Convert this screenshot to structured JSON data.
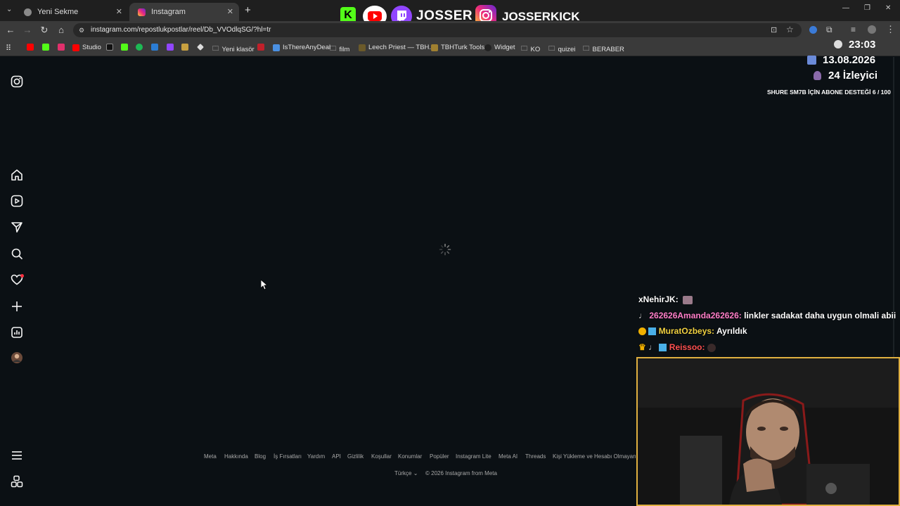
{
  "tabs": [
    {
      "title": "Yeni Sekme",
      "close": "✕"
    },
    {
      "title": "Instagram",
      "close": "✕"
    }
  ],
  "new_tab": "+",
  "window_controls": {
    "minimize": "—",
    "restore": "❐",
    "close": "✕"
  },
  "address_bar": {
    "url": "instagram.com/repostlukpostlar/reel/Db_VVOdlqSG/?hl=tr"
  },
  "bookmarks": [
    {
      "label": "Studio",
      "icon": "youtube-icon",
      "color": "#ff0000"
    },
    {
      "label": "Yeni klasör",
      "icon": "folder-icon"
    },
    {
      "label": "IsThereAnyDeal",
      "icon": "itad-icon",
      "color": "#4a90e2"
    },
    {
      "label": "film",
      "icon": "folder-icon"
    },
    {
      "label": "Leech Priest — TBH...",
      "icon": "page-icon"
    },
    {
      "label": "TBHTurk Tools",
      "icon": "tbh-icon"
    },
    {
      "label": "Widget",
      "icon": "widget-icon"
    },
    {
      "label": "KO",
      "icon": "folder-icon"
    },
    {
      "label": "quizei",
      "icon": "folder-icon"
    },
    {
      "label": "BERABER",
      "icon": "folder-icon"
    }
  ],
  "stream_banner": {
    "josser": "JOSSER",
    "josserkick": "JOSSERKICK"
  },
  "stream_info": {
    "time": "23:03",
    "date": "13.08.2026",
    "viewers": "24 İzleyici",
    "goal": "SHURE SM7B İÇİN ABONE DESTEĞİ 6 / 100"
  },
  "chat": [
    {
      "user": "xNehirJK:",
      "message": "",
      "color": "#ffffff"
    },
    {
      "user": "262626Amanda262626:",
      "message": "linkler sadakat daha uygun olmali abii",
      "color": "#ff7ec8"
    },
    {
      "user": "MuratOzbeys:",
      "message": "Ayrıldık",
      "color": "#f0d040"
    },
    {
      "user": "Reissoo:",
      "message": "",
      "color": "#ff5050"
    }
  ],
  "footer": {
    "links": [
      "Meta",
      "Hakkında",
      "Blog",
      "İş Fırsatları",
      "Yardım",
      "API",
      "Gizlilik",
      "Koşullar",
      "Konumlar",
      "Popüler",
      "Instagram Lite",
      "Meta AI",
      "Threads",
      "Kişi Yükleme ve Hesabı Olmayan K"
    ],
    "language": "Türkçe",
    "copyright": "© 2026 Instagram from Meta"
  },
  "colors": {
    "background": "#0b1014",
    "chrome": "#3a3a3a",
    "tabbar": "#1f1f1f",
    "notification_dot": "#ff3040"
  }
}
